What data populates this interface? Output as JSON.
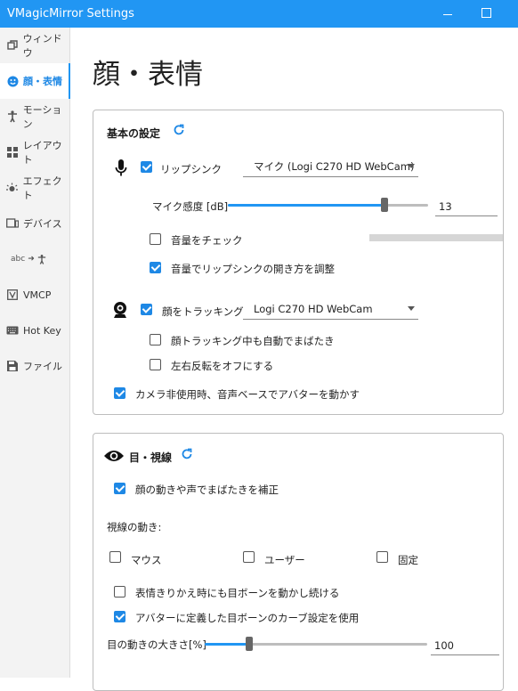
{
  "window": {
    "title": "VMagicMirror Settings"
  },
  "sidebar": {
    "items": [
      {
        "label": "ウィンドウ",
        "icon": "window-icon"
      },
      {
        "label": "顔・表情",
        "icon": "face-icon",
        "active": true
      },
      {
        "label": "モーション",
        "icon": "person-icon"
      },
      {
        "label": "レイアウト",
        "icon": "layout-icon"
      },
      {
        "label": "エフェクト",
        "icon": "effect-icon"
      },
      {
        "label": "デバイス",
        "icon": "device-icon"
      },
      {
        "label": "",
        "icon": "text-to-motion-icon",
        "icon_text": "abc"
      },
      {
        "label": "VMCP",
        "icon": "vmcp-icon"
      },
      {
        "label": "Hot Key",
        "icon": "keyboard-icon"
      },
      {
        "label": "ファイル",
        "icon": "save-icon"
      }
    ]
  },
  "page": {
    "title": "顔・表情"
  },
  "basic": {
    "title": "基本の設定",
    "lipsync_label": "リップシンク",
    "lipsync_checked": true,
    "mic_device": "マイク (Logi C270 HD WebCam)",
    "mic_sensitivity_label": "マイク感度 [dB]",
    "mic_sensitivity_value": "13",
    "mic_sensitivity_fraction": 0.78,
    "volume_check_label": "音量をチェック",
    "volume_check_checked": false,
    "volume_adjust_label": "音量でリップシンクの開き方を調整",
    "volume_adjust_checked": true,
    "face_tracking_label": "顔をトラッキング",
    "face_tracking_checked": true,
    "camera_device": "Logi C270 HD WebCam",
    "auto_blink_label": "顔トラッキング中も自動でまばたき",
    "auto_blink_checked": false,
    "mirror_off_label": "左右反転をオフにする",
    "mirror_off_checked": false,
    "voice_based_label": "カメラ非使用時、音声ベースでアバターを動かす",
    "voice_based_checked": true
  },
  "eye": {
    "title": "目・視線",
    "blink_adjust_label": "顔の動きや声でまばたきを補正",
    "blink_adjust_checked": true,
    "gaze_label": "視線の動き:",
    "gaze_options": [
      {
        "label": "マウス",
        "checked": false
      },
      {
        "label": "ユーザー",
        "checked": false
      },
      {
        "label": "固定",
        "checked": false
      }
    ],
    "keep_bone_label": "表情きりかえ時にも目ボーンを動かし続ける",
    "keep_bone_checked": false,
    "curve_label": "アバターに定義した目ボーンのカーブ設定を使用",
    "curve_checked": true,
    "eye_scale_label": "目の動きの大きさ[%]",
    "eye_scale_value": "100",
    "eye_scale_fraction": 0.2
  },
  "colors": {
    "accent": "#2196f3",
    "titlebar": "#2196f3",
    "sidebar_bg": "#f3f3f3"
  }
}
